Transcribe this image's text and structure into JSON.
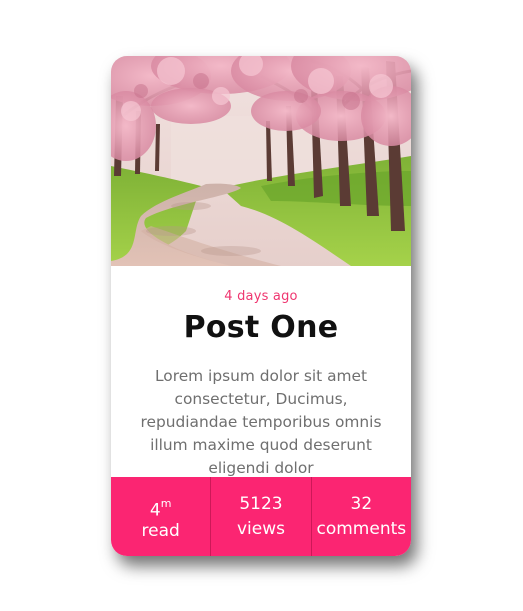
{
  "card": {
    "image": {
      "subject": "cherry blossom trees over a winding path",
      "colors": {
        "sky": "#e8d8d4",
        "blossom": "#e9a6b8",
        "grass": "#8cc63f",
        "path": "#d8b8ad",
        "trunk": "#5b3b34"
      }
    },
    "date": "4 days ago",
    "title": "Post One",
    "description": "Lorem ipsum dolor sit amet consectetur, Ducimus, repudiandae temporibus omnis illum maxime quod deserunt eligendi dolor",
    "stats": [
      {
        "value": "4",
        "value_sup": "m",
        "label": "read"
      },
      {
        "value": "5123",
        "label": "views"
      },
      {
        "value": "32",
        "label": "comments"
      }
    ],
    "accent_color": "#fb2572"
  }
}
